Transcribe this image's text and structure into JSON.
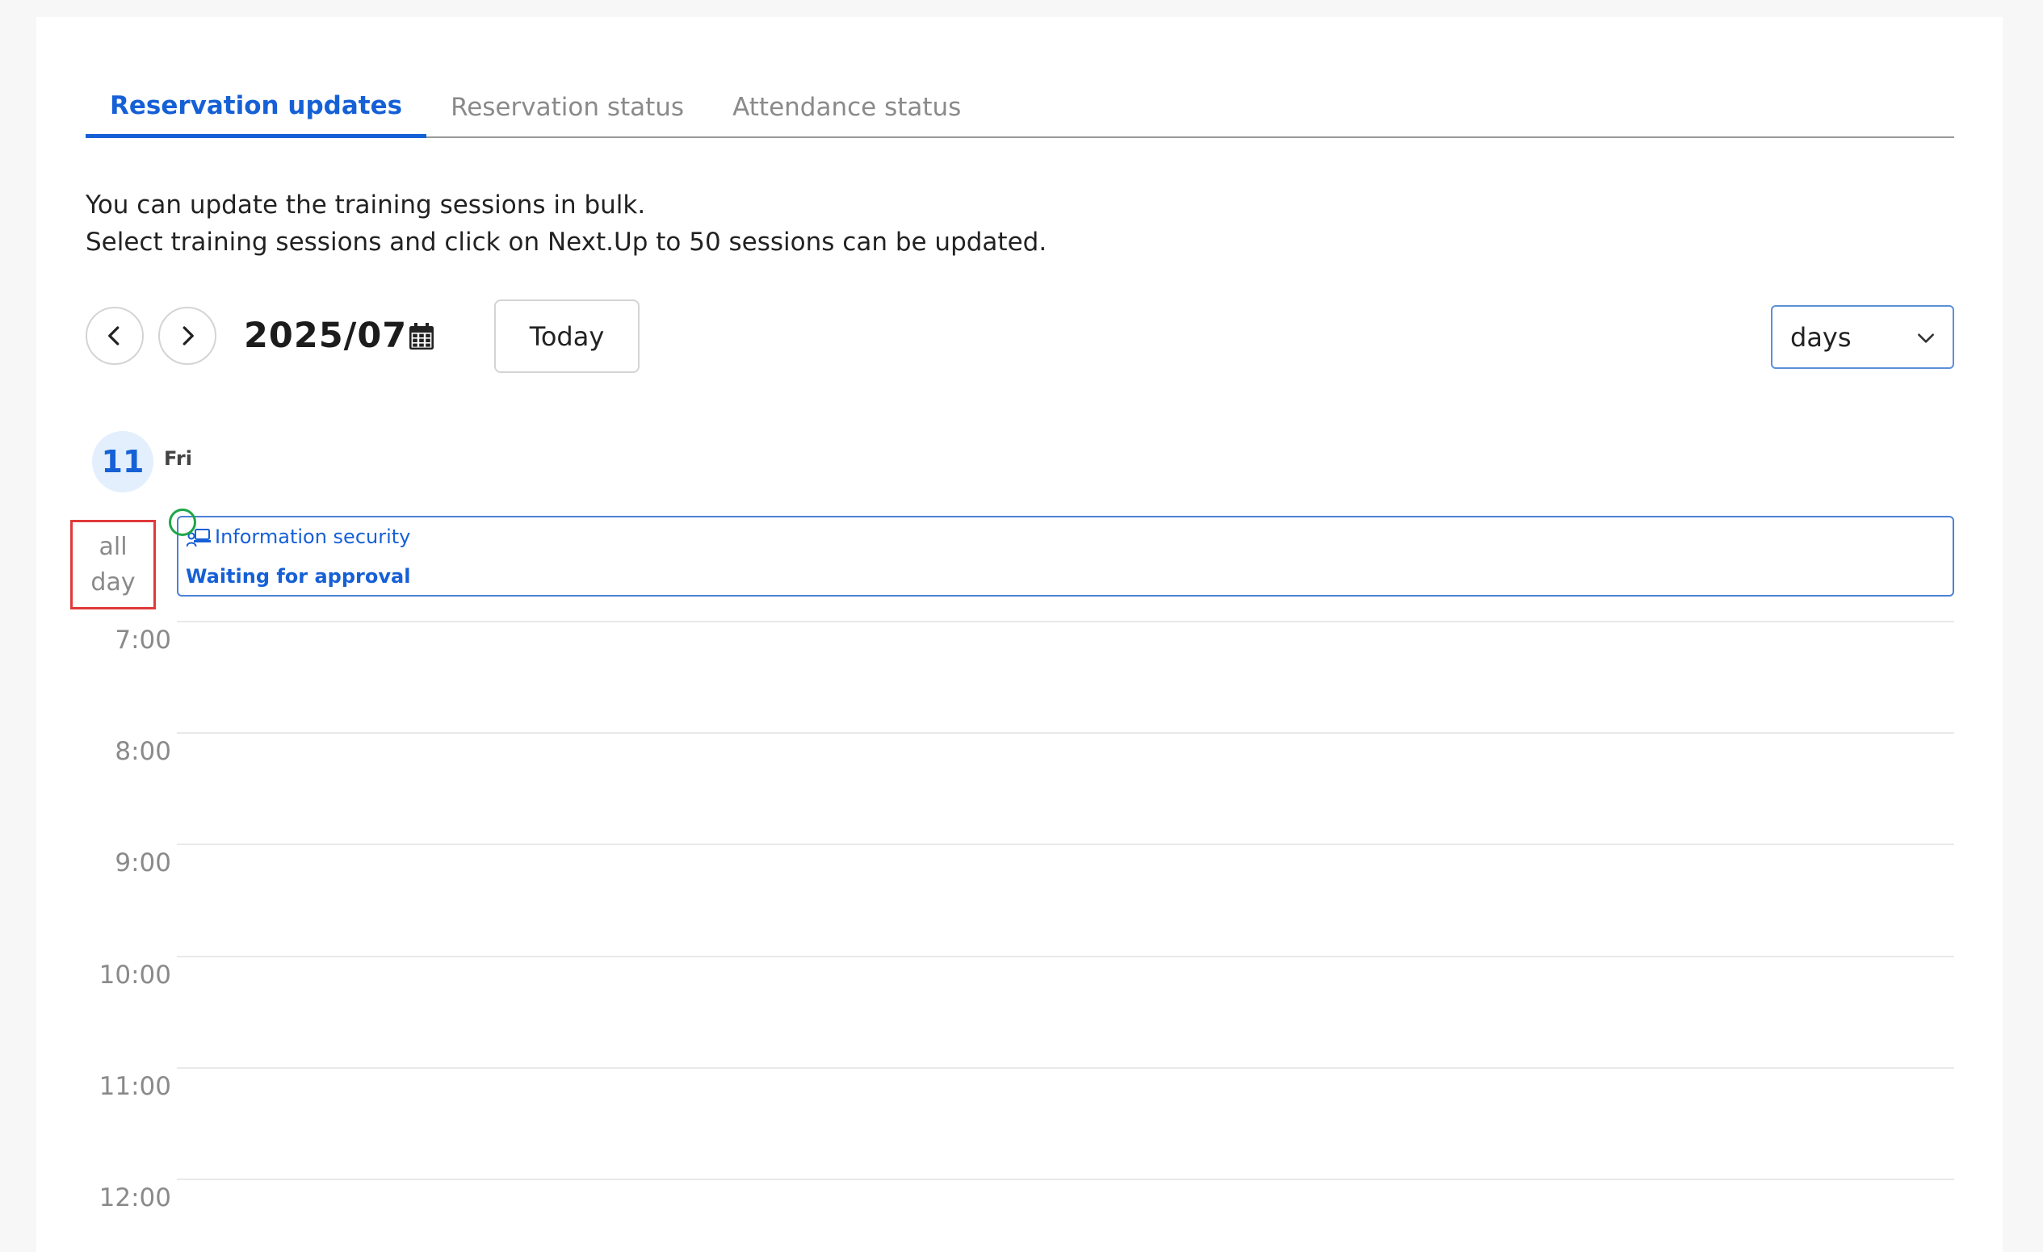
{
  "tabs": [
    {
      "label": "Reservation updates",
      "active": true
    },
    {
      "label": "Reservation status",
      "active": false
    },
    {
      "label": "Attendance status",
      "active": false
    }
  ],
  "description": {
    "line1": "You can update the training sessions in bulk.",
    "line2": "Select training sessions and click on Next.Up to 50 sessions can be updated."
  },
  "toolbar": {
    "prev_icon": "chevron-left-icon",
    "next_icon": "chevron-right-icon",
    "month": "2025/07",
    "calendar_icon": "calendar-icon",
    "today_label": "Today",
    "view_value": "days"
  },
  "day": {
    "number": "11",
    "weekday": "Fri"
  },
  "allday": {
    "line1": "all",
    "line2": "day"
  },
  "event": {
    "icon": "online-training-icon",
    "title": "Information security",
    "status": "Waiting for approval"
  },
  "times": [
    "7:00",
    "8:00",
    "9:00",
    "10:00",
    "11:00",
    "12:00"
  ],
  "colors": {
    "accent": "#1660d6",
    "highlight_border": "#e03a3a",
    "status_dot": "#1fa64a",
    "day_badge_bg": "#e3effc"
  }
}
